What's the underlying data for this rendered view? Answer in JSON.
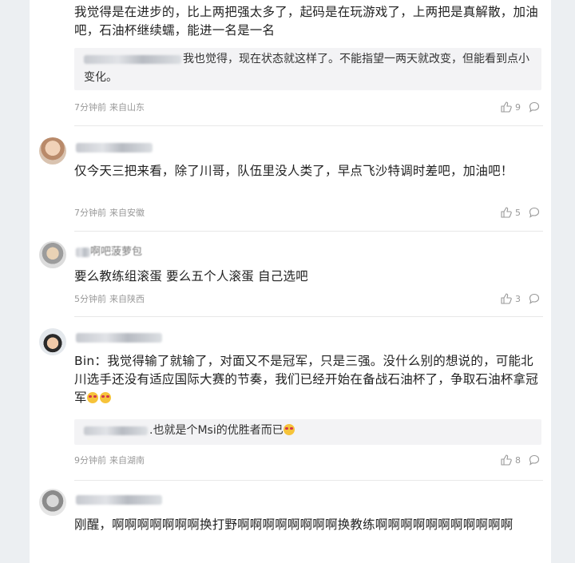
{
  "comments": [
    {
      "text": "我觉得是在进步的，比上两把强太多了，起码是在玩游戏了，上两把是真解散，加油吧，石油杯继续蠕，能进一名是一名",
      "reply": {
        "text": "我也觉得，现在状态就这样了。不能指望一两天就改变，但能看到点小变化。"
      },
      "time": "7分钟前",
      "location": "来自山东",
      "likes": "9"
    },
    {
      "text": "仅今天三把来看，除了川哥，队伍里没人类了，早点飞沙特调时差吧，加油吧！",
      "time": "7分钟前",
      "location": "来自安徽",
      "likes": "5"
    },
    {
      "username_visible": "啊吧菠萝包",
      "text": "要么教练组滚蛋 要么五个人滚蛋 自己选吧",
      "time": "5分钟前",
      "location": "来自陕西",
      "likes": "3"
    },
    {
      "text": "Bin：我觉得输了就输了，对面又不是冠军，只是三强。没什么别的想说的，可能北川选手还没有适应国际大赛的节奏，我们已经开始在备战石油杯了，争取石油杯拿冠军",
      "reply": {
        "text": ".也就是个Msi的优胜者而已"
      },
      "time": "9分钟前",
      "location": "来自湖南",
      "likes": "8"
    },
    {
      "text": "刚醒，啊啊啊啊啊啊啊换打野啊啊啊啊啊啊啊啊换教练啊啊啊啊啊啊啊啊啊啊啊"
    }
  ],
  "icons": {
    "like": "thumbs-up-icon",
    "comment": "comment-bubble-icon"
  }
}
